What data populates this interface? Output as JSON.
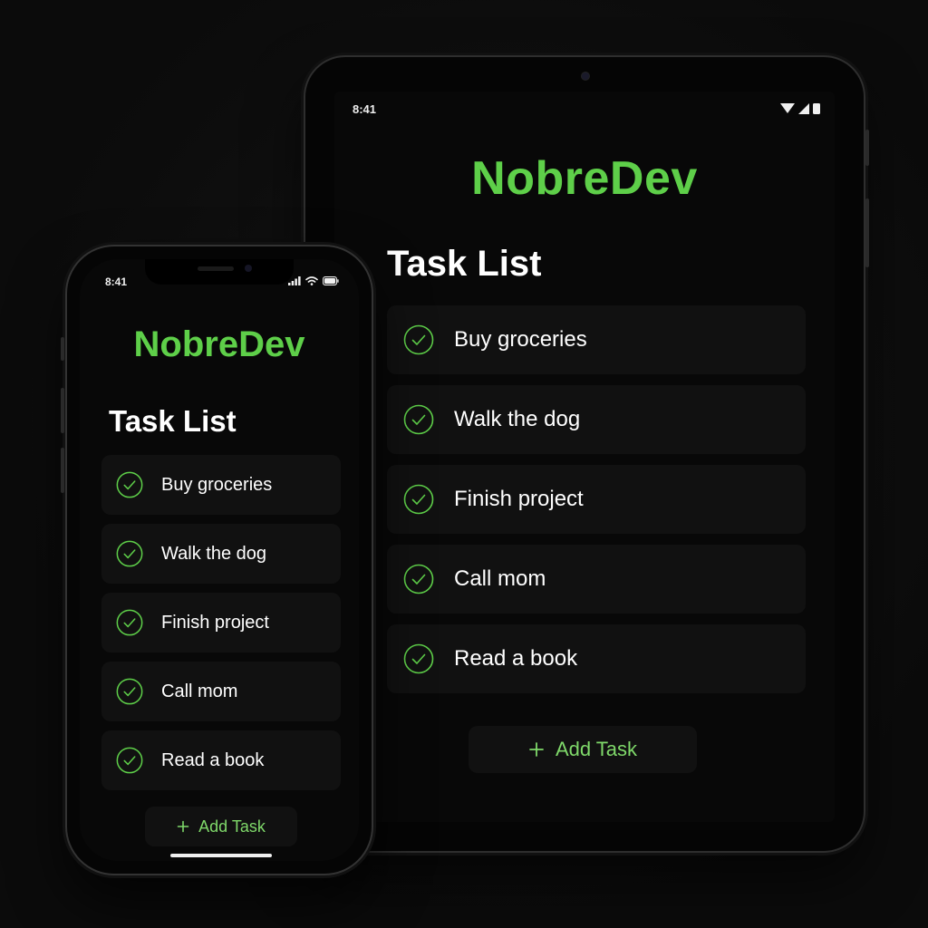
{
  "colors": {
    "brand": "#5ecf49",
    "accent": "#7fd96a",
    "background": "#080808",
    "card": "#111111",
    "text": "#ffffff"
  },
  "tablet": {
    "status": {
      "time": "8:41",
      "icons": [
        "wifi-icon",
        "signal-icon",
        "battery-icon"
      ]
    },
    "brand": "NobreDev",
    "heading": "Task List",
    "tasks": [
      {
        "label": "Buy groceries",
        "icon": "check-circle-icon"
      },
      {
        "label": "Walk the dog",
        "icon": "check-circle-icon"
      },
      {
        "label": "Finish project",
        "icon": "check-circle-icon"
      },
      {
        "label": "Call mom",
        "icon": "check-circle-icon"
      },
      {
        "label": "Read a book",
        "icon": "check-circle-icon"
      }
    ],
    "add_button": {
      "icon": "plus-icon",
      "label": "Add Task"
    }
  },
  "phone": {
    "status": {
      "time": "8:41",
      "icons": [
        "signal-icon",
        "wifi-icon",
        "battery-icon"
      ]
    },
    "brand": "NobreDev",
    "heading": "Task List",
    "tasks": [
      {
        "label": "Buy groceries",
        "icon": "check-circle-icon"
      },
      {
        "label": "Walk the dog",
        "icon": "check-circle-icon"
      },
      {
        "label": "Finish project",
        "icon": "check-circle-icon"
      },
      {
        "label": "Call mom",
        "icon": "check-circle-icon"
      },
      {
        "label": "Read a book",
        "icon": "check-circle-icon"
      }
    ],
    "add_button": {
      "icon": "plus-icon",
      "label": "Add Task"
    }
  }
}
